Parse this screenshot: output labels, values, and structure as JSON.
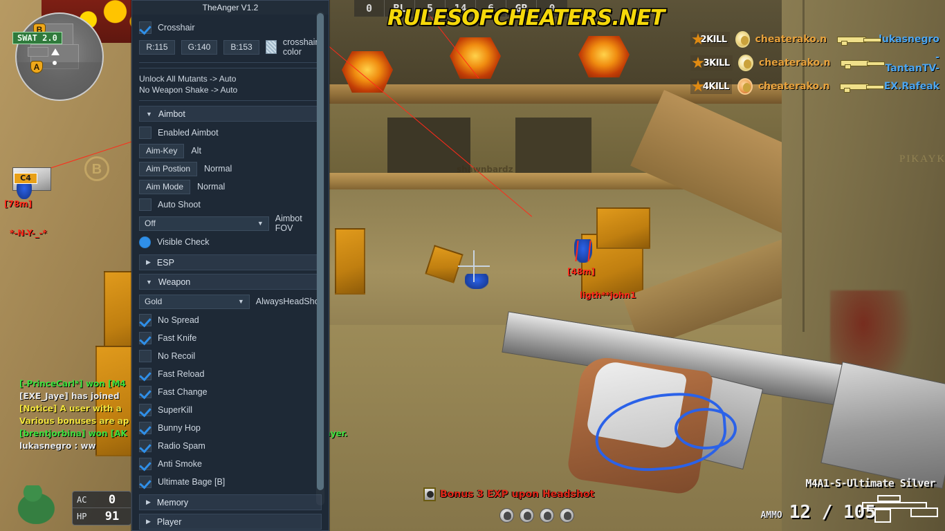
{
  "game": {
    "watermark": "RULESOFCHEATERS.NET",
    "background_text": "PIKAYKA",
    "scorebar": [
      {
        "value": "0",
        "type": "score"
      },
      {
        "value": "BL",
        "type": "team"
      },
      {
        "value": "5",
        "type": "score"
      },
      {
        "value": "14",
        "type": "score"
      },
      {
        "value": "6",
        "type": "score"
      },
      {
        "value": "GR",
        "type": "team"
      },
      {
        "value": "0",
        "type": "score"
      }
    ],
    "minimap": {
      "site_a": "A",
      "site_b": "B"
    },
    "killfeed": [
      {
        "streak": "2KILL",
        "killer": "cheaterako.n",
        "weapon": "rifle-icon",
        "victim": "lukasnegro"
      },
      {
        "streak": "3KILL",
        "killer": "cheaterako.n",
        "weapon": "rifle-icon",
        "victim": "-TantanTV-"
      },
      {
        "streak": "4KILL",
        "killer": "cheaterako.n",
        "weapon": "rifle-icon",
        "victim": "EX.Rafeak"
      }
    ],
    "esp": {
      "c4_tag": "C4",
      "c4_distance": "[78m]",
      "c4_player": "*-N-Y-_-*",
      "enemy_distance": "[48m]",
      "enemy_player": "ligth**john1",
      "far_player": "shawnbardz"
    },
    "chat": [
      {
        "text": "[-PrinceCarl*] won [M4",
        "color": "green"
      },
      {
        "text": "[EXE_Jaye] has joined",
        "color": "white"
      },
      {
        "text": "[Notice] A user with a",
        "color": "yellow"
      },
      {
        "text": "Various bonuses are ap",
        "color": "yellow"
      },
      {
        "text": "[brentjorbina] won [AK",
        "color": "green"
      },
      {
        "text": "lukasnegro : ww",
        "color": "white"
      }
    ],
    "chat_overlap": "layer.",
    "hud": {
      "class_badge": "SWAT 2.0",
      "ac_label": "AC",
      "ac_value": "0",
      "hp_label": "HP",
      "hp_value": "91",
      "bonus_text": "Bonus 3 EXP upon Headshot",
      "weapon_name": "M4A1-S-Ultimate Silver",
      "ammo_label": "AMMO",
      "ammo_value": "12 / 105"
    }
  },
  "cheatmenu": {
    "title": "TheAnger V1.2",
    "crosshair": {
      "label": "Crosshair",
      "checked": true,
      "r_label": "R:115",
      "g_label": "G:140",
      "b_label": "B:153",
      "color_label": "crosshair color"
    },
    "statics": [
      "Unlock All Mutants    -> Auto",
      "No Weapon Shake ->   Auto"
    ],
    "sections": [
      {
        "name": "Aimbot",
        "expanded": true,
        "arrow": "▼",
        "rows": [
          {
            "kind": "checkbox",
            "label": "Enabled Aimbot",
            "checked": false
          },
          {
            "kind": "keyvalue",
            "key": "Aim-Key",
            "value": "Alt"
          },
          {
            "kind": "keyvalue",
            "key": "Aim Postion",
            "value": "Normal"
          },
          {
            "kind": "keyvalue",
            "key": "Aim Mode",
            "value": "Normal"
          },
          {
            "kind": "checkbox",
            "label": "Auto Shoot",
            "checked": false
          },
          {
            "kind": "select",
            "value": "Off",
            "right": "Aimbot FOV"
          },
          {
            "kind": "radio",
            "label": "Visible Check",
            "checked": true
          }
        ]
      },
      {
        "name": "ESP",
        "expanded": false,
        "arrow": "▶",
        "rows": []
      },
      {
        "name": "Weapon",
        "expanded": true,
        "arrow": "▼",
        "rows": [
          {
            "kind": "select",
            "value": "Gold",
            "right": "AlwaysHeadShot"
          },
          {
            "kind": "checkbox",
            "label": "No Spread",
            "checked": true
          },
          {
            "kind": "checkbox",
            "label": "Fast Knife",
            "checked": true
          },
          {
            "kind": "checkbox",
            "label": "No Recoil",
            "checked": false
          },
          {
            "kind": "checkbox",
            "label": "Fast Reload",
            "checked": true
          },
          {
            "kind": "checkbox",
            "label": "Fast Change",
            "checked": true
          },
          {
            "kind": "checkbox",
            "label": "SuperKill",
            "checked": true
          },
          {
            "kind": "checkbox",
            "label": "Bunny Hop",
            "checked": true
          },
          {
            "kind": "checkbox",
            "label": "Radio Spam",
            "checked": true
          },
          {
            "kind": "checkbox",
            "label": "Anti Smoke",
            "checked": true
          },
          {
            "kind": "checkbox",
            "label": "Ultimate Bage [B]",
            "checked": true
          }
        ]
      },
      {
        "name": "Memory",
        "expanded": false,
        "arrow": "▶",
        "rows": []
      },
      {
        "name": "Player",
        "expanded": false,
        "arrow": "▶",
        "rows": []
      }
    ]
  }
}
